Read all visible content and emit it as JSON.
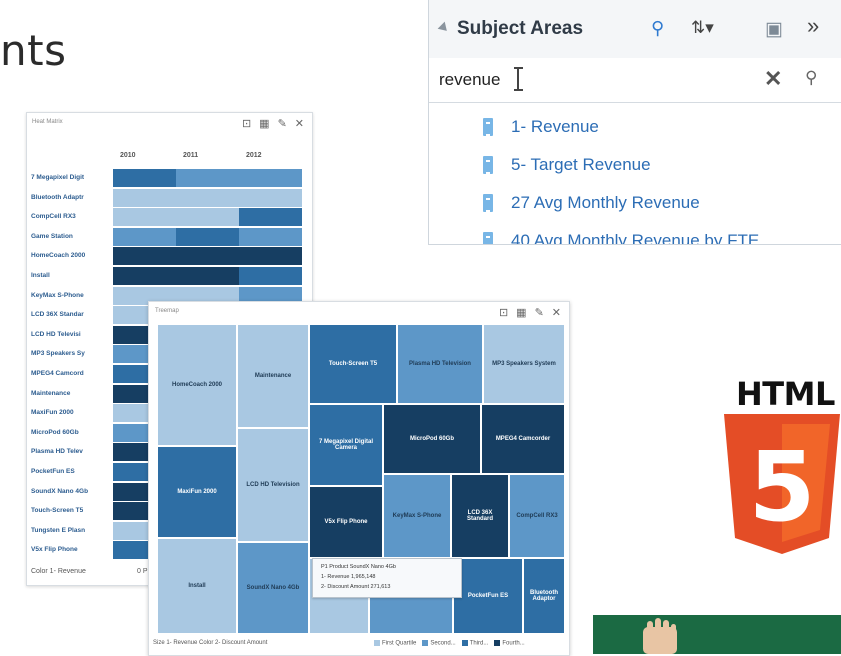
{
  "page": {
    "title_fragment": "nts"
  },
  "subject_areas": {
    "title": "Subject Areas",
    "search_value": "revenue",
    "icons": {
      "collapse": "collapse-triangle-icon",
      "search": "search-icon",
      "sort": "sort-icon",
      "export": "export-icon",
      "more": "double-chevron-icon",
      "clear": "clear-x-icon",
      "find": "magnifier-icon"
    },
    "icon_glyphs": {
      "search": "⚲",
      "sort": "⇅▾",
      "export": "▣",
      "more": "»",
      "clear": "✕",
      "find": "⚲"
    },
    "items": [
      {
        "label": "1- Revenue"
      },
      {
        "label": "5- Target Revenue"
      },
      {
        "label": "27 Avg Monthly Revenue"
      },
      {
        "label": "40 Avg Monthly Revenue by FTE"
      }
    ]
  },
  "heatmap": {
    "title": "Heat Matrix",
    "years": [
      "2010",
      "2011",
      "2012"
    ],
    "rows": [
      {
        "label": "7 Megapixel Digit",
        "shades": [
          3,
          2,
          2
        ]
      },
      {
        "label": "Bluetooth Adaptr",
        "shades": [
          1,
          1,
          1
        ]
      },
      {
        "label": "CompCell RX3",
        "shades": [
          1,
          1,
          3
        ]
      },
      {
        "label": "Game Station",
        "shades": [
          2,
          3,
          2
        ]
      },
      {
        "label": "HomeCoach 2000",
        "shades": [
          4,
          4,
          4
        ]
      },
      {
        "label": "Install",
        "shades": [
          4,
          4,
          3
        ]
      },
      {
        "label": "KeyMax S-Phone",
        "shades": [
          1,
          1,
          2
        ]
      },
      {
        "label": "LCD 36X Standar",
        "shades": [
          1,
          2,
          1
        ]
      },
      {
        "label": "LCD HD Televisi",
        "shades": [
          4,
          3,
          3
        ]
      },
      {
        "label": "MP3 Speakers Sy",
        "shades": [
          2,
          1,
          2
        ]
      },
      {
        "label": "MPEG4 Camcord",
        "shades": [
          3,
          2,
          2
        ]
      },
      {
        "label": "Maintenance",
        "shades": [
          4,
          3,
          2
        ]
      },
      {
        "label": "MaxiFun 2000",
        "shades": [
          1,
          2,
          1
        ]
      },
      {
        "label": "MicroPod 60Gb",
        "shades": [
          2,
          1,
          2
        ]
      },
      {
        "label": "Plasma HD Telev",
        "shades": [
          4,
          2,
          3
        ]
      },
      {
        "label": "PocketFun ES",
        "shades": [
          3,
          2,
          2
        ]
      },
      {
        "label": "SoundX Nano 4Gb",
        "shades": [
          4,
          2,
          3
        ]
      },
      {
        "label": "Touch-Screen T5",
        "shades": [
          4,
          3,
          3
        ]
      },
      {
        "label": "Tungsten E Plasn",
        "shades": [
          1,
          1,
          2
        ]
      },
      {
        "label": "V5x Flip Phone",
        "shades": [
          3,
          2,
          2
        ]
      }
    ],
    "footer": "Color  1- Revenue",
    "footer_right": "0 P"
  },
  "treemap": {
    "title": "Treemap",
    "tiles": [
      {
        "label": "HomeCoach 2000",
        "shade": 1
      },
      {
        "label": "Maintenance",
        "shade": 1
      },
      {
        "label": "Touch-Screen T5",
        "shade": 3
      },
      {
        "label": "Plasma HD Television",
        "shade": 2
      },
      {
        "label": "MP3 Speakers System",
        "shade": 1
      },
      {
        "label": "7 Megapixel Digital Camera",
        "shade": 3
      },
      {
        "label": "MicroPod 60Gb",
        "shade": 4
      },
      {
        "label": "MPEG4 Camcorder",
        "shade": 4
      },
      {
        "label": "MaxiFun 2000",
        "shade": 3
      },
      {
        "label": "LCD HD Television",
        "shade": 1
      },
      {
        "label": "V5x Flip Phone",
        "shade": 4
      },
      {
        "label": "KeyMax S-Phone",
        "shade": 2
      },
      {
        "label": "LCD 36X Standard",
        "shade": 4
      },
      {
        "label": "CompCell RX3",
        "shade": 2
      },
      {
        "label": "Install",
        "shade": 1
      },
      {
        "label": "SoundX Nano 4Gb",
        "shade": 2
      },
      {
        "label": "",
        "shade": 1
      },
      {
        "label": "",
        "shade": 2
      },
      {
        "label": "PocketFun ES",
        "shade": 3
      },
      {
        "label": "Bluetooth Adaptor",
        "shade": 3
      }
    ],
    "tooltip": {
      "product": "P1 Product  SoundX Nano 4Gb",
      "revenue": "1- Revenue  1,965,148",
      "discount": "2- Discount Amount  271,613"
    },
    "footer": "Size  1- Revenue   Color  2- Discount Amount",
    "legend": [
      {
        "label": "First Quartile",
        "shade": 1
      },
      {
        "label": "Second...",
        "shade": 2
      },
      {
        "label": "Third...",
        "shade": 3
      },
      {
        "label": "Fourth...",
        "shade": 4
      }
    ]
  },
  "html5": {
    "text": "HTML",
    "digit": "5"
  },
  "colors": {
    "shade1": "#a9c8e2",
    "shade2": "#5d97c8",
    "shade3": "#2e6ea4",
    "shade4": "#163e62",
    "html5_orange": "#e44d26",
    "html5_light": "#f16529",
    "link_blue": "#2c6db5"
  }
}
